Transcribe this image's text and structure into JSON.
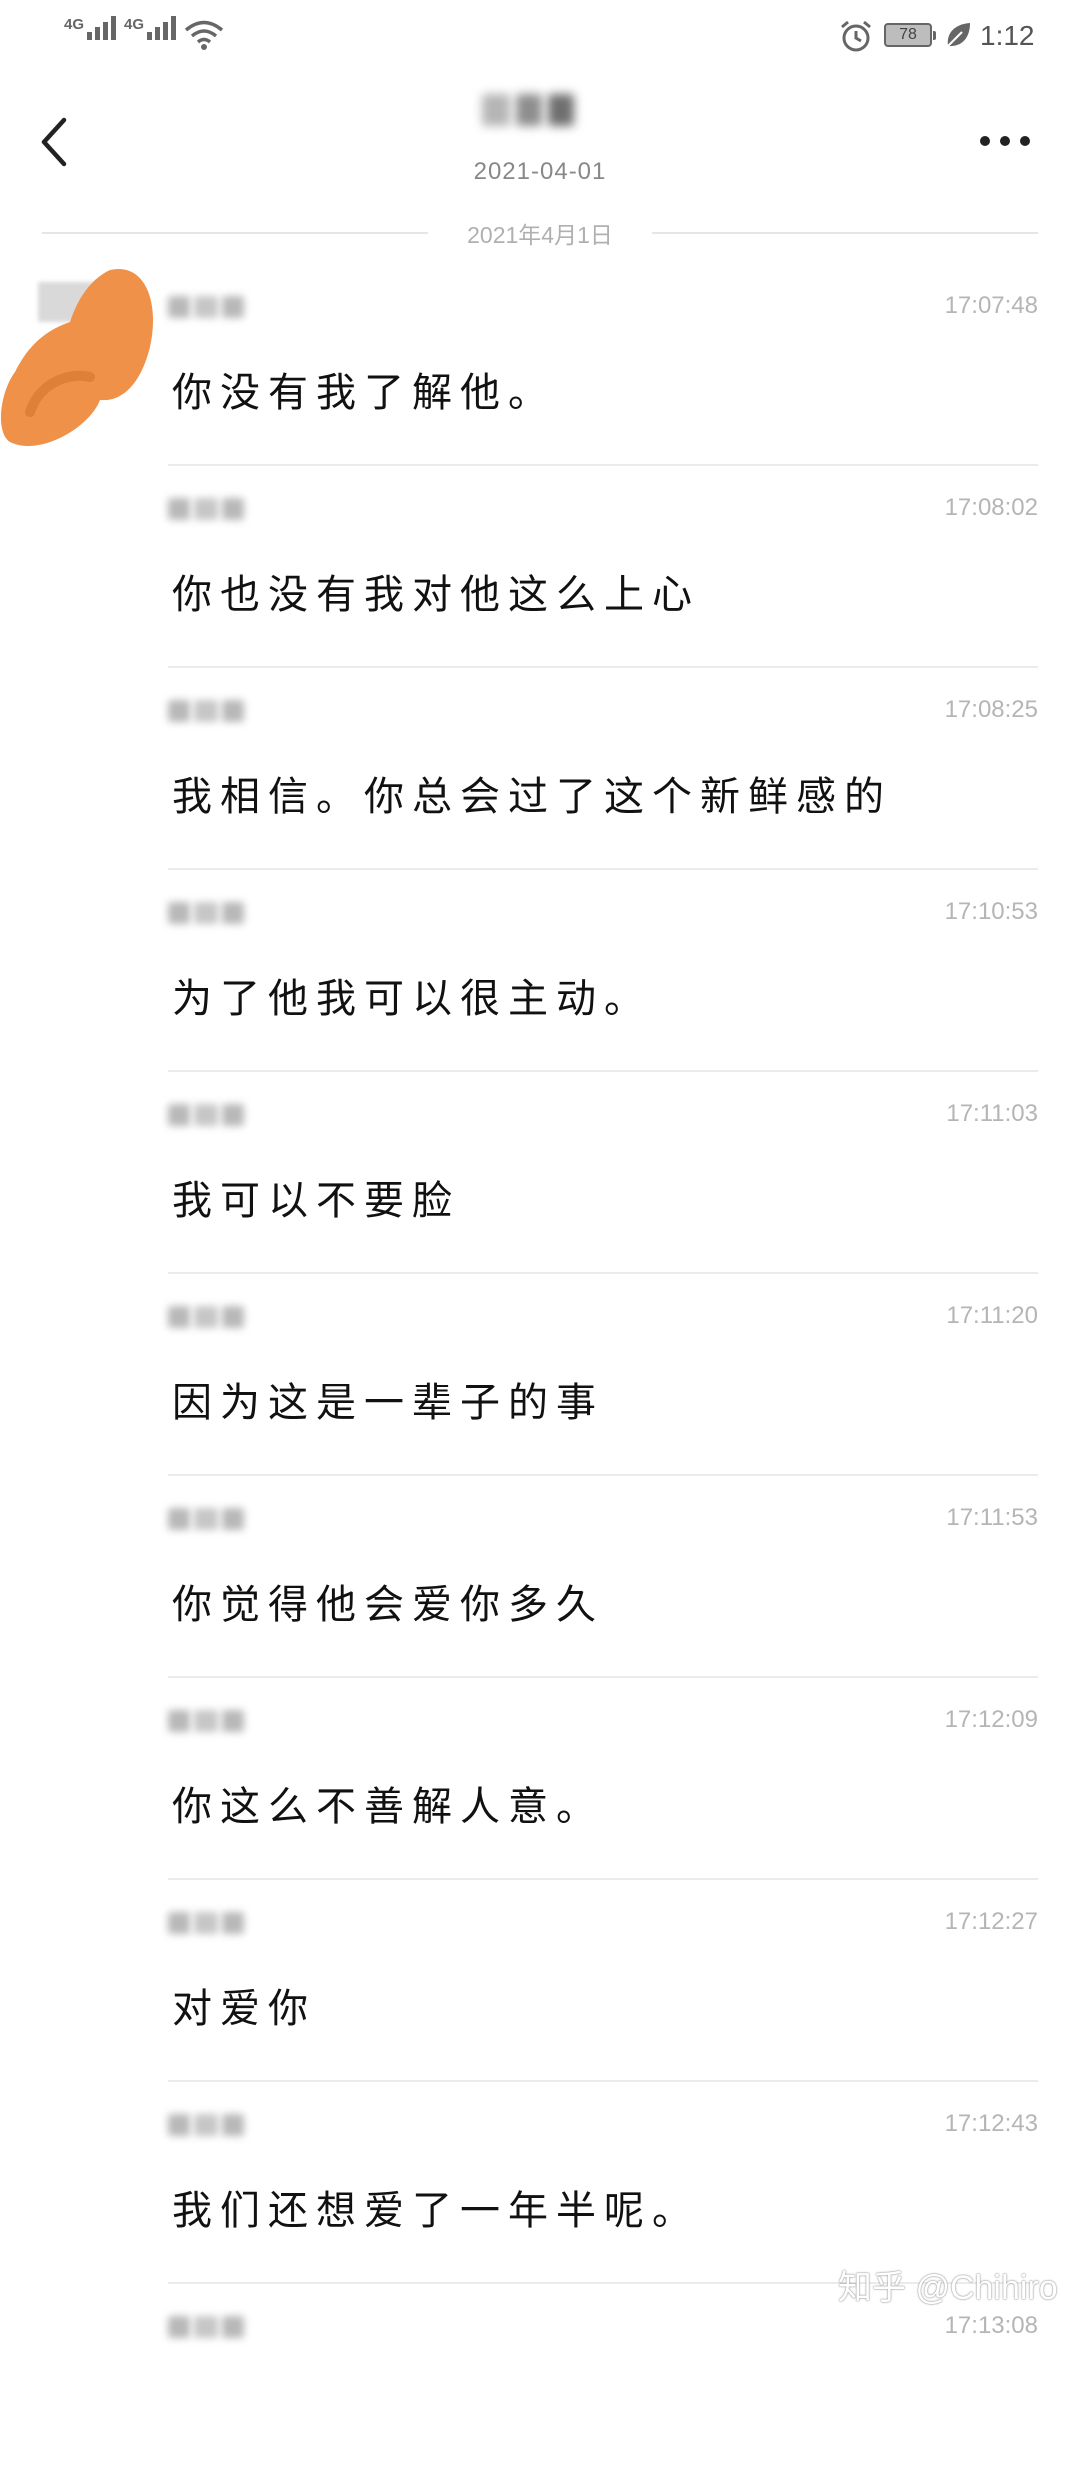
{
  "status_bar": {
    "network_1": "4G",
    "network_2": "4G",
    "battery": "78",
    "time": "1:12"
  },
  "header": {
    "date": "2021-04-01",
    "divider_date": "2021年4月1日"
  },
  "messages": [
    {
      "time": "17:07:48",
      "text": "你没有我了解他。"
    },
    {
      "time": "17:08:02",
      "text": "你也没有我对他这么上心"
    },
    {
      "time": "17:08:25",
      "text": "我相信。你总会过了这个新鲜感的"
    },
    {
      "time": "17:10:53",
      "text": "为了他我可以很主动。"
    },
    {
      "time": "17:11:03",
      "text": "我可以不要脸"
    },
    {
      "time": "17:11:20",
      "text": "因为这是一辈子的事"
    },
    {
      "time": "17:11:53",
      "text": "你觉得他会爱你多久"
    },
    {
      "time": "17:12:09",
      "text": "你这么不善解人意。"
    },
    {
      "time": "17:12:27",
      "text": "对爱你"
    },
    {
      "time": "17:12:43",
      "text": "我们还想爱了一年半呢。"
    },
    {
      "time": "17:13:08",
      "text": ""
    }
  ],
  "watermark": "知乎 @Chihiro",
  "colors": {
    "avatar_scribble": "#f0914a"
  }
}
